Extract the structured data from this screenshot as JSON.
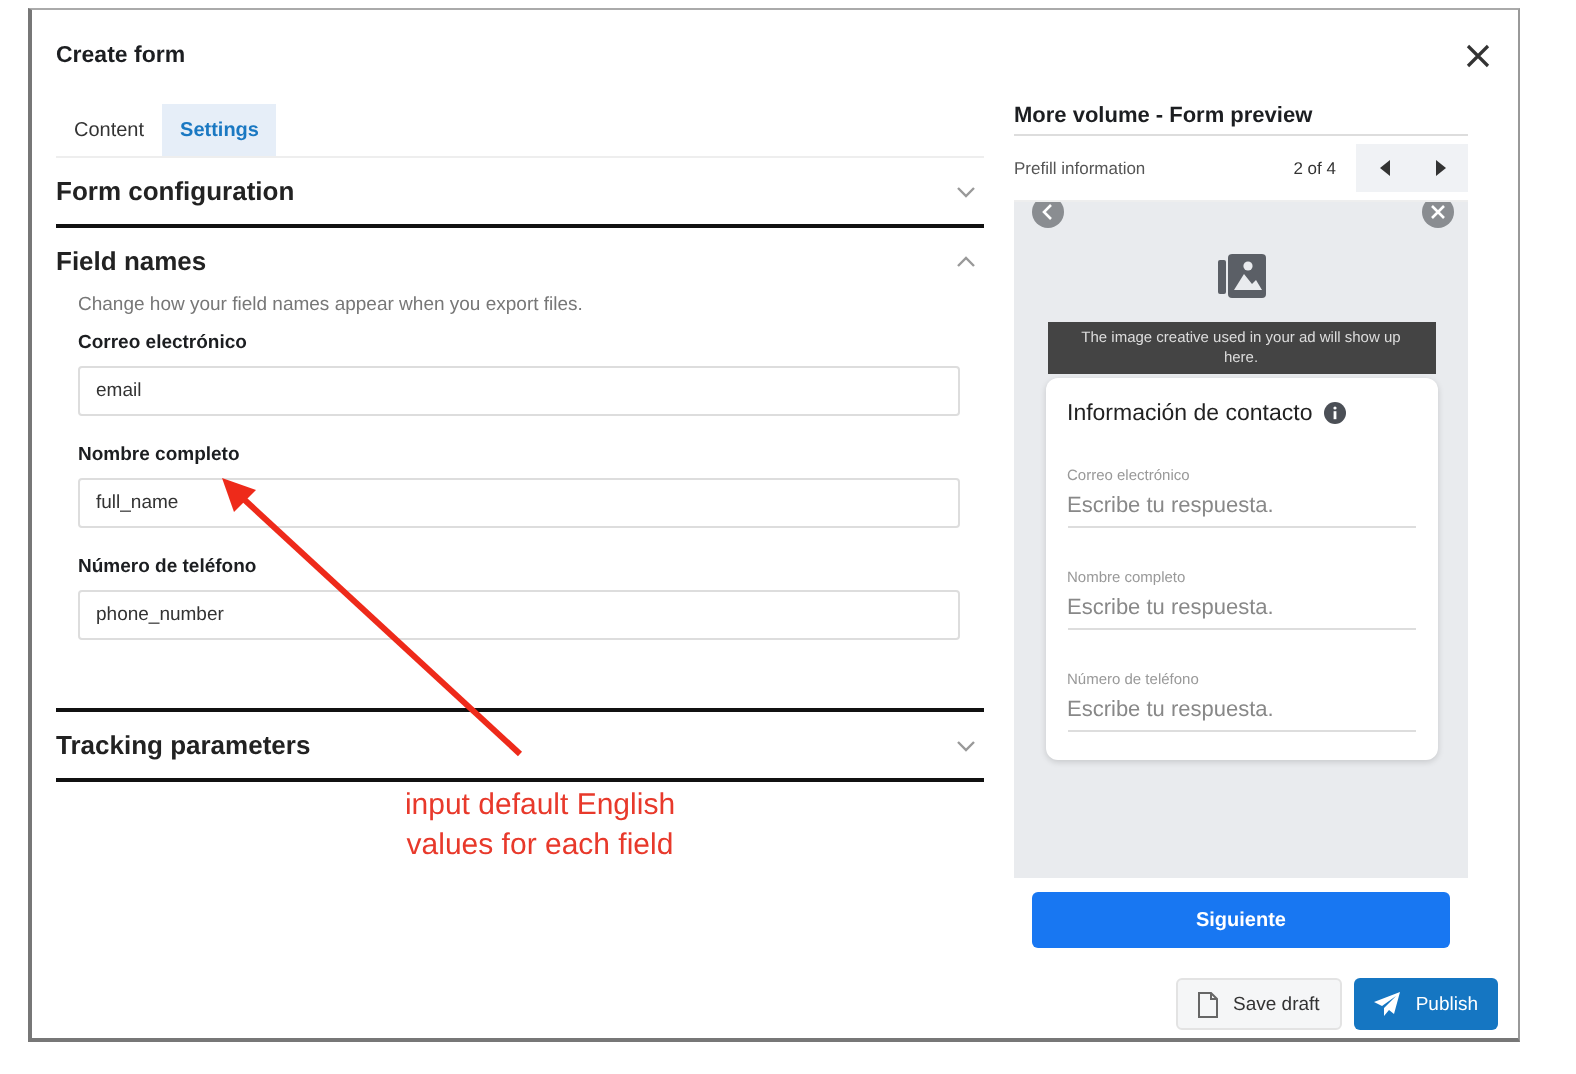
{
  "window": {
    "title": "Create form"
  },
  "tabs": [
    {
      "label": "Content",
      "selected": false
    },
    {
      "label": "Settings",
      "selected": true
    }
  ],
  "sections": [
    {
      "title": "Form configuration",
      "expanded": false
    },
    {
      "title": "Field names",
      "expanded": true,
      "description": "Change how your field names appear when you export files.",
      "fields": [
        {
          "label": "Correo electrónico",
          "value": "email"
        },
        {
          "label": "Nombre completo",
          "value": "full_name"
        },
        {
          "label": "Número de teléfono",
          "value": "phone_number"
        }
      ]
    },
    {
      "title": "Tracking parameters",
      "expanded": false
    }
  ],
  "preview": {
    "title": "More volume - Form preview",
    "step_label": "Prefill information",
    "counter": "2 of 4",
    "image_notice": "The image creative used in your ad will show up here.",
    "card_title": "Información de contacto",
    "fields": [
      {
        "label": "Correo electrónico",
        "placeholder": "Escribe tu respuesta."
      },
      {
        "label": "Nombre completo",
        "placeholder": "Escribe tu respuesta."
      },
      {
        "label": "Número de teléfono",
        "placeholder": "Escribe tu respuesta."
      }
    ],
    "button": "Siguiente"
  },
  "buttons": [
    {
      "label": "Save draft",
      "kind": "secondary"
    },
    {
      "label": "Publish",
      "kind": "primary"
    }
  ],
  "annotation": {
    "text": "input default English\nvalues for each field"
  }
}
